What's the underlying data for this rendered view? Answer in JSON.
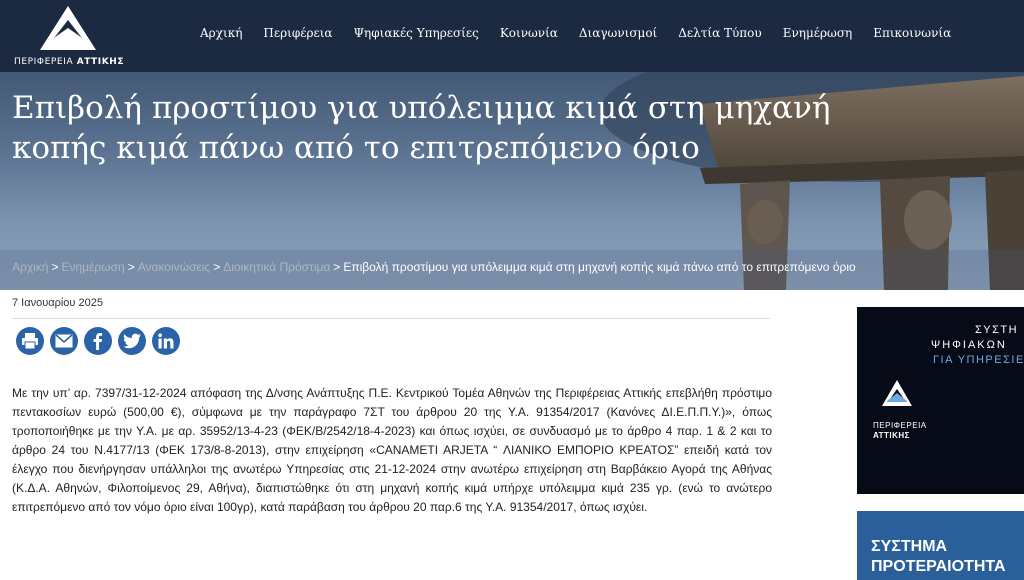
{
  "header": {
    "logo_text_prefix": "ΠΕΡΙΦΕΡΕΙΑ",
    "logo_text_bold": "ΑΤΤΙΚΗΣ",
    "nav": [
      {
        "label": "Αρχική"
      },
      {
        "label": "Περιφέρεια"
      },
      {
        "label": "Ψηφιακές Υπηρεσίες"
      },
      {
        "label": "Κοινωνία"
      },
      {
        "label": "Διαγωνισμοί"
      },
      {
        "label": "Δελτία Τύπου"
      },
      {
        "label": "Ενημέρωση"
      },
      {
        "label": "Επικοινωνία"
      }
    ]
  },
  "hero": {
    "title": "Επιβολή προστίμου για υπόλειμμα κιμά στη μηχανή κοπής κιμά πάνω από το επιτρεπόμενο όριο",
    "breadcrumb": [
      {
        "label": "Αρχική"
      },
      {
        "label": "Ενημέρωση"
      },
      {
        "label": "Ανακοινώσεις"
      },
      {
        "label": "Διοικητικά Πρόστιμα"
      }
    ],
    "breadcrumb_separator": ">",
    "breadcrumb_current": "Επιβολή προστίμου για υπόλειμμα κιμά στη μηχανή κοπής κιμά πάνω από το επιτρεπόμενο όριο"
  },
  "article": {
    "date": "7 Ιανουαρίου 2025",
    "share": [
      "print-icon",
      "email-icon",
      "facebook-icon",
      "twitter-icon",
      "linkedin-icon"
    ],
    "body": "Με την υπ’ αρ. 7397/31-12-2024  απόφαση της Δ/νσης Ανάπτυξης Π.Ε. Κεντρικού Τομέα Αθηνών της Περιφέρειας Αττικής επεβλήθη πρόστιμο πεντακοσίων  ευρώ  (500,00  €), σύμφωνα με την παράγραφο 7ΣΤ του άρθρου 20 της Υ.Α. 91354/2017 (Κανόνες ΔΙ.Ε.Π.Π.Υ.)», όπως τροποποιήθηκε με την Υ.Α. με αρ. 35952/13-4-23 (ΦΕΚ/Β/2542/18-4-2023) και όπως ισχύει,  σε συνδυασμό  με  το  άρθρο  4  παρ.  1 & 2  και  το άρθρο 24 του Ν.4177/13 (ΦΕΚ 173/8-8-2013), στην επιχείρηση «CANAMETI ARJETA “ ΛΙΑΝΙΚΟ ΕΜΠΟΡΙΟ ΚΡΕΑΤΟΣ”  επειδή κατά τον έλεγχο που διενήργησαν υπάλληλοι της ανωτέρω Υπηρεσίας στις 21-12-2024 στην ανωτέρω επιχείρηση στη Βαρβάκειο Αγορά της Αθήνας (Κ.Δ.Α. Αθηνών, Φιλοποίμενος 29, Αθήνα),  διαπιστώθηκε ότι στη μηχανή κοπής κιμά υπήρχε υπόλειμμα κιμά 235 γρ. (ενώ το ανώτερο επιτρεπόμενο από τον νόμο όριο είναι 100γρ), κατά παράβαση του άρθρου 20 παρ.6 της Υ.Α. 91354/2017, όπως ισχύει."
  },
  "sidebar": {
    "banner1": {
      "line1": "ΣΥΣΤΗ",
      "line2": "ΨΗΦΙΑΚΩΝ",
      "line3": "ΓΙΑ ΥΠΗΡΕΣΙΕ",
      "logo_line1": "ΠΕΡΙΦΕΡΕΙΑ",
      "logo_line2": "ΑΤΤΙΚΗΣ"
    },
    "banner2": {
      "line1": "ΣΥΣΤΗΜΑ",
      "line2": "ΠΡΟΤΕΡΑΙΟΤΗΤΑ"
    }
  },
  "colors": {
    "header_bg": "#1b2941",
    "share_blue": "#2b63a8",
    "banner2_bg": "#2a5f9a"
  }
}
